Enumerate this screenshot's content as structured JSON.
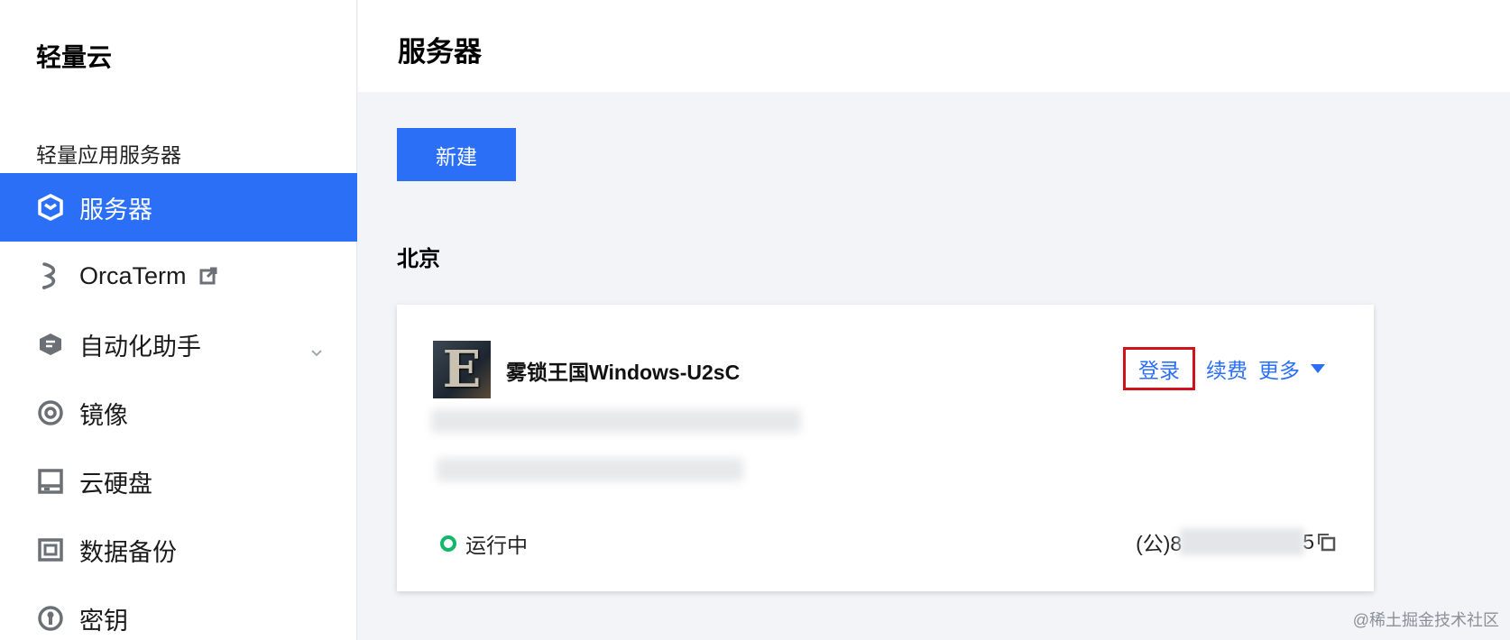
{
  "sidebar": {
    "brand": "轻量云",
    "group_label": "轻量应用服务器",
    "items": [
      {
        "label": "服务器",
        "icon": "server-cube-icon",
        "active": true
      },
      {
        "label": "OrcaTerm",
        "icon": "orcaterm-icon",
        "external": true
      },
      {
        "label": "自动化助手",
        "icon": "automation-icon",
        "expandable": true
      },
      {
        "label": "镜像",
        "icon": "image-disc-icon"
      },
      {
        "label": "云硬盘",
        "icon": "cloud-disk-icon"
      },
      {
        "label": "数据备份",
        "icon": "backup-icon"
      },
      {
        "label": "密钥",
        "icon": "key-icon"
      }
    ]
  },
  "header": {
    "title": "服务器"
  },
  "toolbar": {
    "new_label": "新建"
  },
  "region": "北京",
  "instance": {
    "thumbnail_letter": "E",
    "name": "雾锁王国Windows-U2sC",
    "actions": {
      "login": "登录",
      "renew": "续费",
      "more": "更多"
    },
    "status": "运行中",
    "ip_prefix": "(公)8",
    "ip_suffix": "5"
  },
  "watermark": "@稀土掘金技术社区",
  "colors": {
    "accent": "#2b6ff7",
    "status_running": "#12b76a",
    "highlight_border": "#d0121b"
  }
}
